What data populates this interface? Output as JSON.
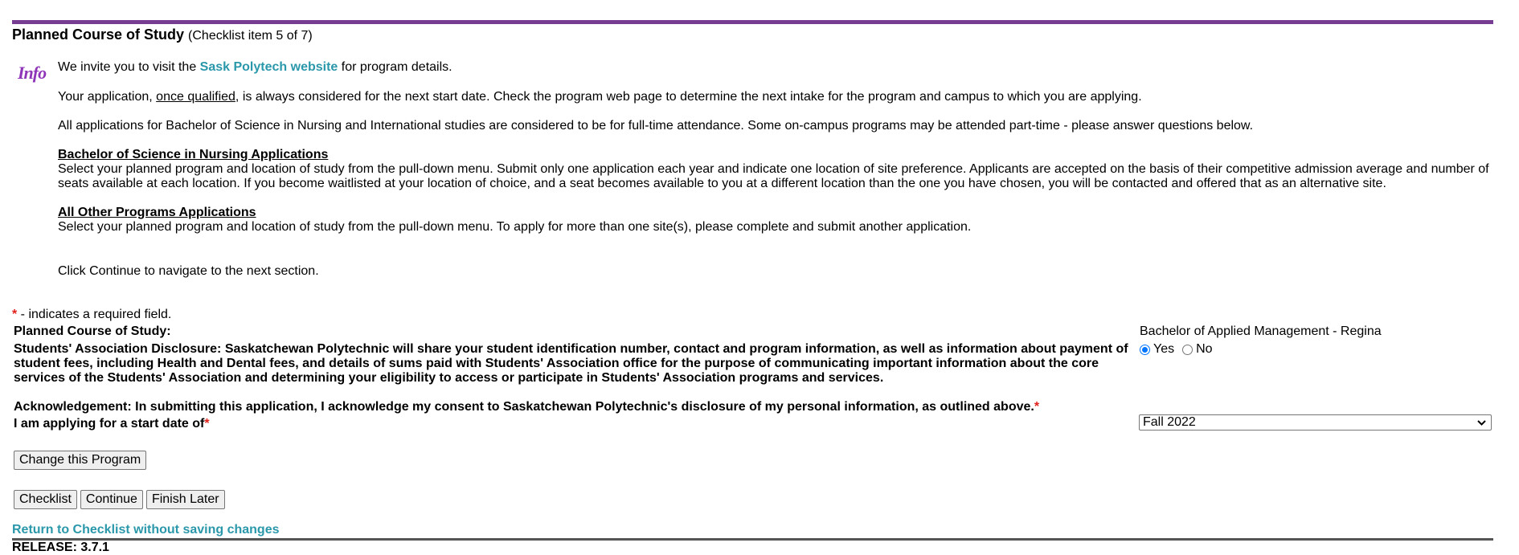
{
  "header": {
    "title": "Planned Course of Study",
    "subtitle": "(Checklist item 5 of 7)"
  },
  "info": {
    "icon_label": "Info",
    "line1_pre": "We invite you to visit the ",
    "line1_link": "Sask Polytech website",
    "line1_post": " for program details.",
    "line2_pre": "Your application, ",
    "line2_underlined": "once qualified",
    "line2_post": ", is always considered for the next start date. Check the program web page to determine the next intake for the program and campus to which you are applying.",
    "line3": "All applications for Bachelor of Science in Nursing and International studies are considered to be for full-time attendance. Some on-campus programs may be attended part-time - please answer questions below.",
    "bsn_heading": "Bachelor of Science in Nursing Applications",
    "bsn_body": "Select your planned program and location of study from the pull-down menu. Submit only one application each year and indicate one location of site preference. Applicants are accepted on the basis of their competitive admission average and number of seats available at each location. If you become waitlisted at your location of choice, and a seat becomes available to you at a different location than the one you have chosen, you will be contacted and offered that as an alternative site.",
    "other_heading": "All Other Programs Applications",
    "other_body": "Select your planned program and location of study from the pull-down menu. To apply for more than one site(s), please complete and submit another application.",
    "continue_note": "Click Continue to navigate to the next section."
  },
  "form": {
    "required_marker": "*",
    "required_note": " - indicates a required field.",
    "planned_course_label": "Planned Course of Study:",
    "planned_course_value": "Bachelor of Applied Management - Regina",
    "disclosure_label": "Students' Association Disclosure: Saskatchewan Polytechnic will share your student identification number, contact and program information, as well as information about payment of student fees, including Health and Dental fees, and details of sums paid with Students' Association office for the purpose of communicating important information about the core services of the Students' Association and determining your eligibility to access or participate in Students' Association programs and services.",
    "disclosure_options": [
      {
        "label": "Yes",
        "selected": true
      },
      {
        "label": "No",
        "selected": false
      }
    ],
    "acknowledgement_label": "Acknowledgement: In submitting this application, I acknowledge my consent to Saskatchewan Polytechnic's disclosure of my personal information, as outlined above.",
    "start_date_label": "I am applying for a start date of",
    "start_date_value": "Fall 2022"
  },
  "buttons": {
    "change_program": "Change this Program",
    "checklist": "Checklist",
    "continue": "Continue",
    "finish_later": "Finish Later"
  },
  "footer": {
    "return_link": "Return to Checklist without saving changes",
    "release": "RELEASE: 3.7.1"
  },
  "colors": {
    "accent_purple": "#773d93",
    "link_teal": "#2a98aa",
    "required_red": "#e0201b",
    "radio_blue": "#0075ff"
  }
}
